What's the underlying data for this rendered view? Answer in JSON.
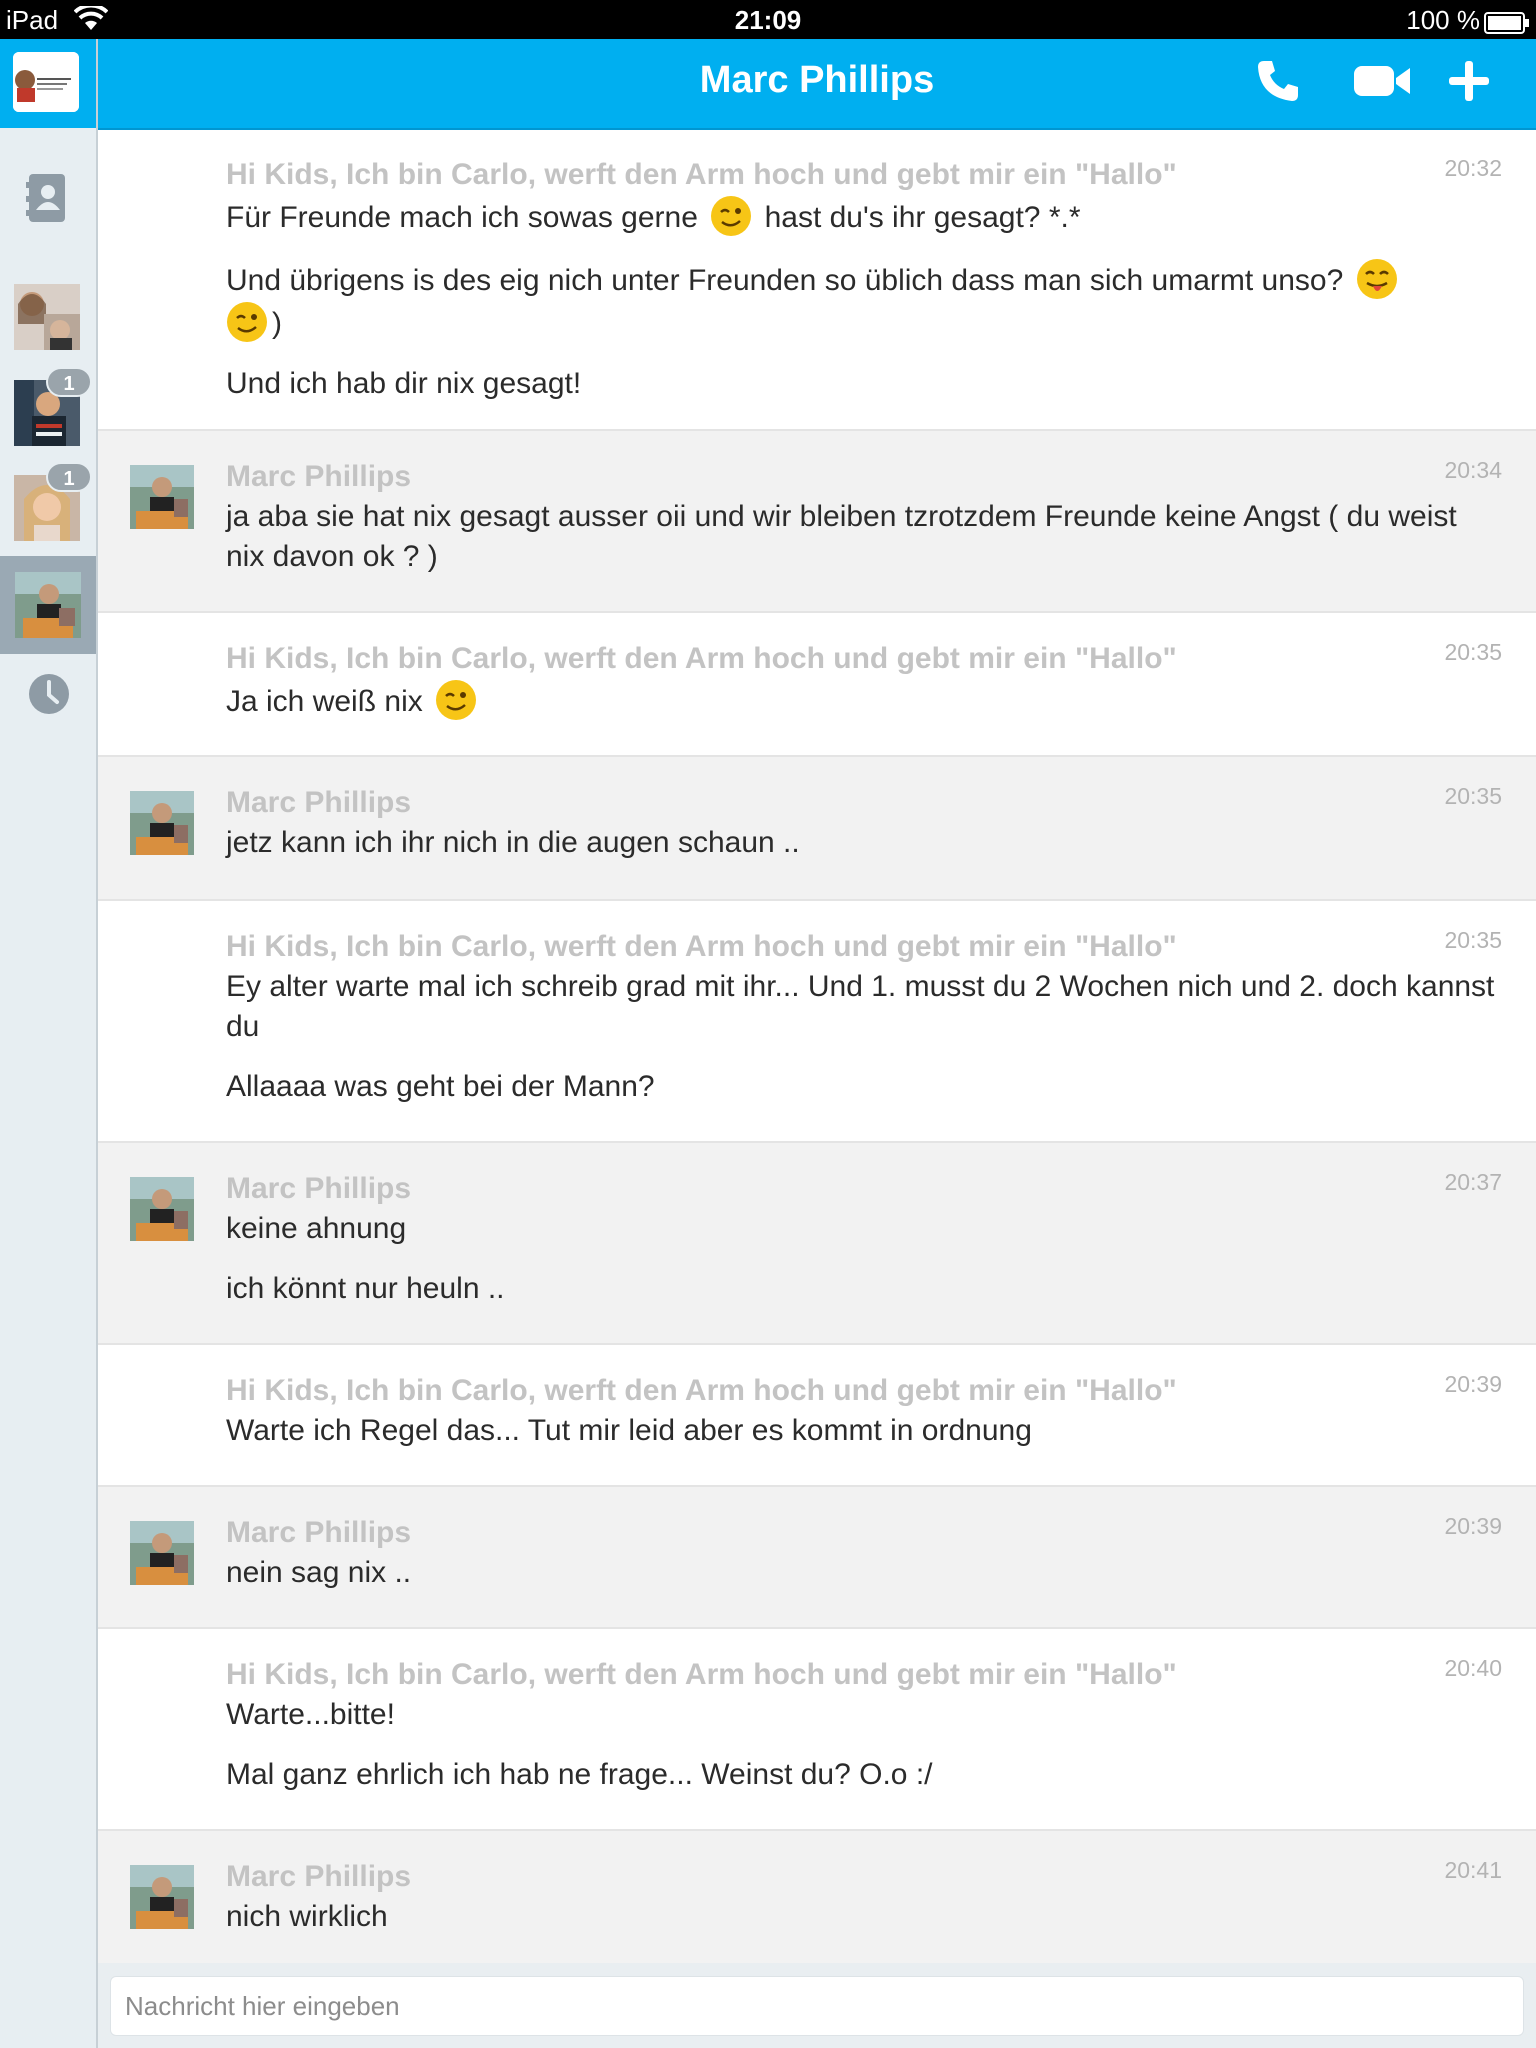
{
  "status_bar": {
    "device": "iPad",
    "time": "21:09",
    "battery": "100 %"
  },
  "colors": {
    "accent": "#00aff0",
    "sidebar_bg": "#e7eef2",
    "alt_row": "#f2f2f2",
    "sender_text": "#c3c3c3"
  },
  "header": {
    "title": "Marc Phillips",
    "actions": [
      "phone-icon",
      "video-icon",
      "add-icon"
    ]
  },
  "sidebar": {
    "items": [
      {
        "icon": "profile-avatar"
      },
      {
        "icon": "contacts-icon"
      },
      {
        "icon": "conversation-avatar"
      },
      {
        "icon": "conversation-avatar",
        "badge": "1"
      },
      {
        "icon": "conversation-avatar",
        "badge": "1"
      },
      {
        "icon": "conversation-avatar",
        "selected": true
      },
      {
        "icon": "history-icon"
      }
    ]
  },
  "messages": [
    {
      "sender": "Hi Kids, Ich bin Carlo, werft den Arm hoch und gebt mir ein \"Hallo\"",
      "time": "20:32",
      "lines": [
        {
          "a": "Für Freunde mach ich sowas gerne",
          "b": "hast du's ihr gesagt? *.*"
        },
        {
          "a": "Und übrigens is des eig nich unter Freunden so üblich dass man sich umarmt unso?",
          "b": ")"
        },
        {
          "a": "Und ich hab dir nix gesagt!"
        }
      ]
    },
    {
      "sender": "Marc Phillips",
      "time": "20:34",
      "lines": [
        {
          "a": "ja aba sie hat nix gesagt ausser oii und wir bleiben tzrotzdem Freunde keine Angst ( du weist nix davon ok ? )"
        }
      ]
    },
    {
      "sender": "Hi Kids, Ich bin Carlo, werft den Arm hoch und gebt mir ein \"Hallo\"",
      "time": "20:35",
      "lines": [
        {
          "a": "Ja ich weiß nix"
        }
      ]
    },
    {
      "sender": "Marc Phillips",
      "time": "20:35",
      "lines": [
        {
          "a": "jetz kann ich ihr nich in die augen schaun .."
        }
      ]
    },
    {
      "sender": "Hi Kids, Ich bin Carlo, werft den Arm hoch und gebt mir ein \"Hallo\"",
      "time": "20:35",
      "lines": [
        {
          "a": "Ey alter warte mal ich schreib grad mit ihr... Und 1. musst du 2 Wochen nich und 2. doch kannst du"
        },
        {
          "a": "Allaaaa was geht bei der Mann?"
        }
      ]
    },
    {
      "sender": "Marc Phillips",
      "time": "20:37",
      "lines": [
        {
          "a": "keine ahnung"
        },
        {
          "a": "ich könnt nur heuln .."
        }
      ]
    },
    {
      "sender": "Hi Kids, Ich bin Carlo, werft den Arm hoch und gebt mir ein \"Hallo\"",
      "time": "20:39",
      "lines": [
        {
          "a": "Warte ich Regel das... Tut mir leid aber es kommt in ordnung"
        }
      ]
    },
    {
      "sender": "Marc Phillips",
      "time": "20:39",
      "lines": [
        {
          "a": "nein sag nix .."
        }
      ]
    },
    {
      "sender": "Hi Kids, Ich bin Carlo, werft den Arm hoch und gebt mir ein \"Hallo\"",
      "time": "20:40",
      "lines": [
        {
          "a": "Warte...bitte!"
        },
        {
          "a": "Mal ganz ehrlich ich hab ne frage... Weinst du? O.o :/"
        }
      ]
    },
    {
      "sender": "Marc Phillips",
      "time": "20:41",
      "lines": [
        {
          "a": "nich wirklich"
        }
      ]
    }
  ],
  "composer": {
    "placeholder": "Nachricht hier eingeben"
  }
}
